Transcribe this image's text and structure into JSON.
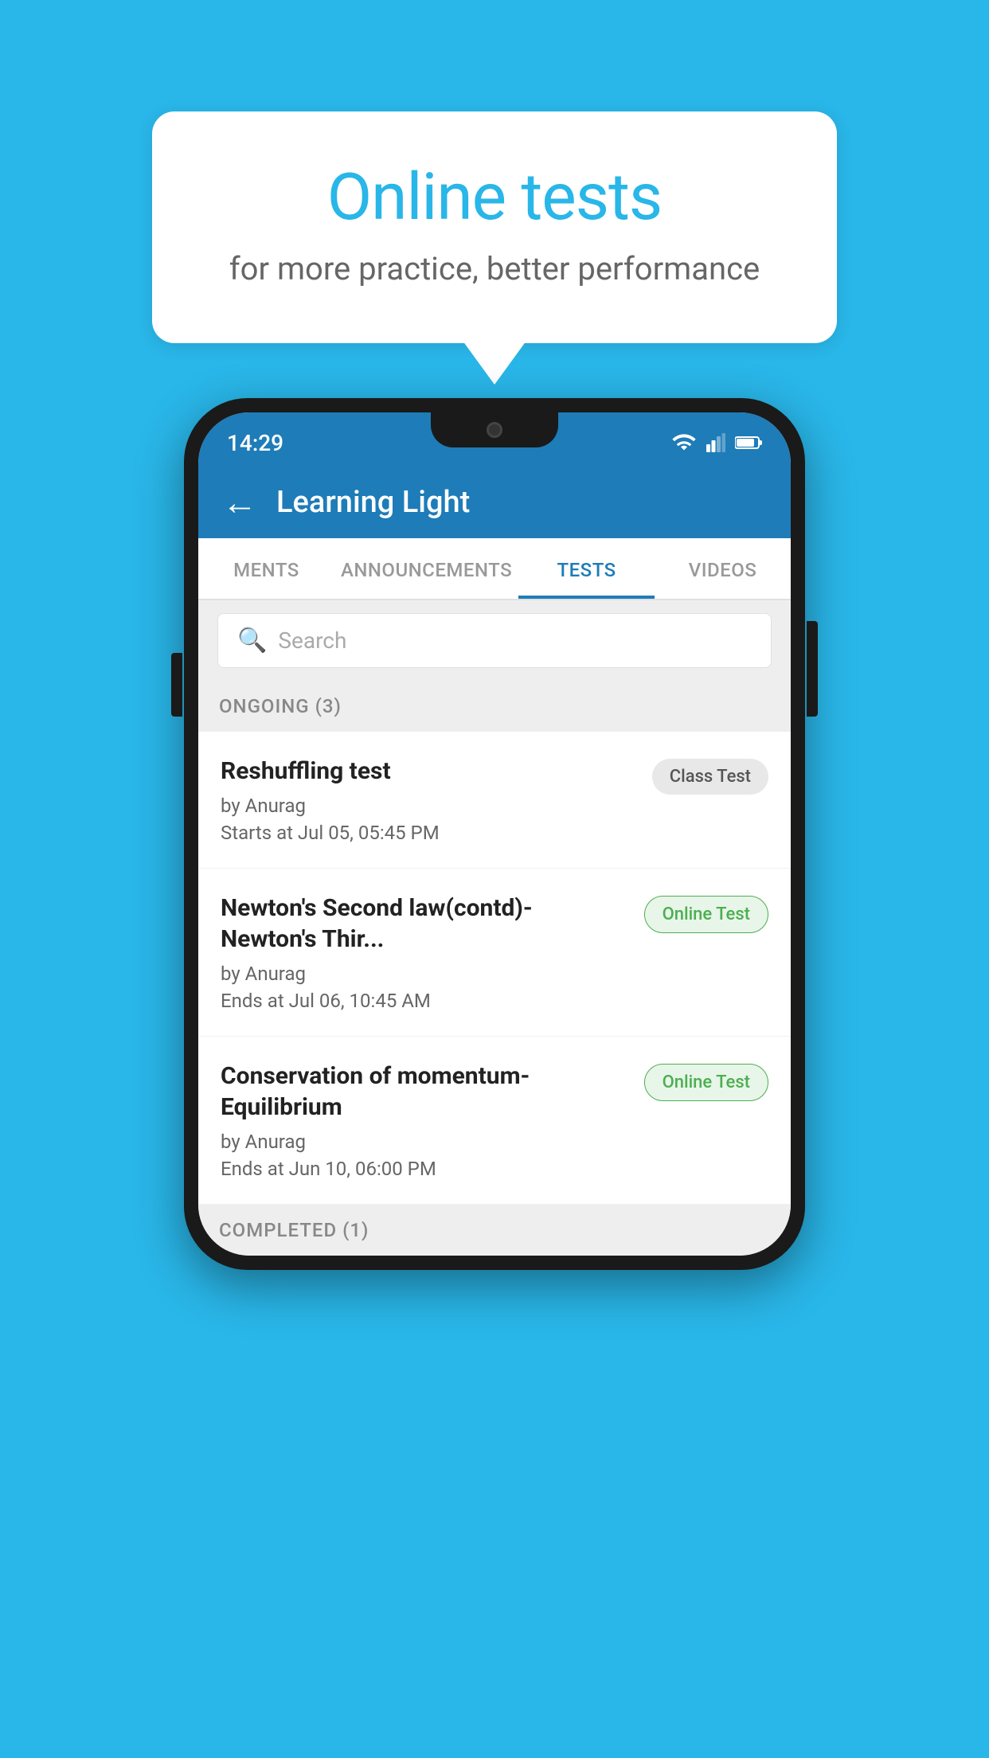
{
  "background": {
    "color": "#29b6e8"
  },
  "speech_bubble": {
    "title": "Online tests",
    "subtitle": "for more practice, better performance"
  },
  "phone": {
    "status_bar": {
      "time": "14:29",
      "icons": [
        "wifi",
        "signal",
        "battery"
      ]
    },
    "app_bar": {
      "title": "Learning Light",
      "back_label": "←"
    },
    "tabs": [
      {
        "label": "MENTS",
        "active": false
      },
      {
        "label": "ANNOUNCEMENTS",
        "active": false
      },
      {
        "label": "TESTS",
        "active": true
      },
      {
        "label": "VIDEOS",
        "active": false
      }
    ],
    "search": {
      "placeholder": "Search"
    },
    "ongoing_section": {
      "title": "ONGOING (3)",
      "items": [
        {
          "name": "Reshuffling test",
          "by": "by Anurag",
          "time": "Starts at  Jul 05, 05:45 PM",
          "badge": "Class Test",
          "badge_type": "class"
        },
        {
          "name": "Newton's Second law(contd)-Newton's Thir...",
          "by": "by Anurag",
          "time": "Ends at  Jul 06, 10:45 AM",
          "badge": "Online Test",
          "badge_type": "online"
        },
        {
          "name": "Conservation of momentum-Equilibrium",
          "by": "by Anurag",
          "time": "Ends at  Jun 10, 06:00 PM",
          "badge": "Online Test",
          "badge_type": "online"
        }
      ]
    },
    "completed_section": {
      "title": "COMPLETED (1)"
    }
  }
}
